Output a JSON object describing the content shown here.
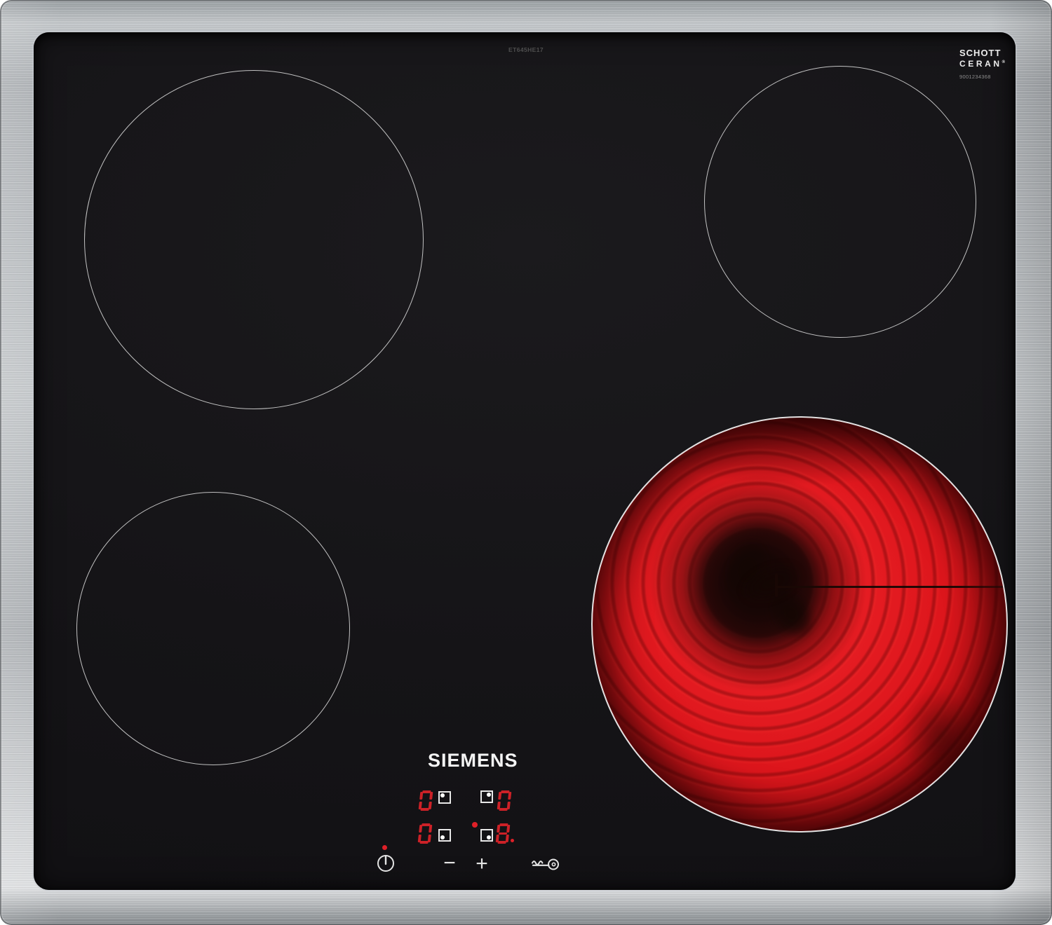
{
  "device": {
    "brand": "SIEMENS",
    "model": "ET645HE17",
    "glass_brand": {
      "line1": "SCHOTT",
      "line2": "CERAN",
      "reg": "®",
      "code": "9001234368"
    }
  },
  "zones": [
    {
      "name": "back-left",
      "state": "off",
      "level": "0"
    },
    {
      "name": "back-right",
      "state": "off",
      "level": "0"
    },
    {
      "name": "front-left",
      "state": "off",
      "level": "0"
    },
    {
      "name": "right-active",
      "state": "glowing",
      "level": "8"
    }
  ],
  "control_panel": {
    "displays": [
      {
        "zone": "back-left",
        "digit": "0",
        "dot_corner": "tl",
        "active_dot": false,
        "decimal_dot": false
      },
      {
        "zone": "back-right",
        "digit": "0",
        "dot_corner": "tr",
        "active_dot": false,
        "decimal_dot": false
      },
      {
        "zone": "front-left",
        "digit": "0",
        "dot_corner": "bl",
        "active_dot": false,
        "decimal_dot": false
      },
      {
        "zone": "front-right",
        "digit": "8",
        "dot_corner": "br",
        "active_dot": true,
        "decimal_dot": true
      }
    ],
    "minus_label": "−",
    "plus_label": "+",
    "power_indicator_on": true,
    "icons": {
      "power": "power-icon",
      "lock": "key-icon"
    }
  },
  "colors": {
    "display_red": "#cc2127",
    "indicator_red": "#df2028",
    "zone_outline": "#e0e0e0",
    "glass_black": "#151417",
    "frame_steel": "#c0c4c8"
  }
}
